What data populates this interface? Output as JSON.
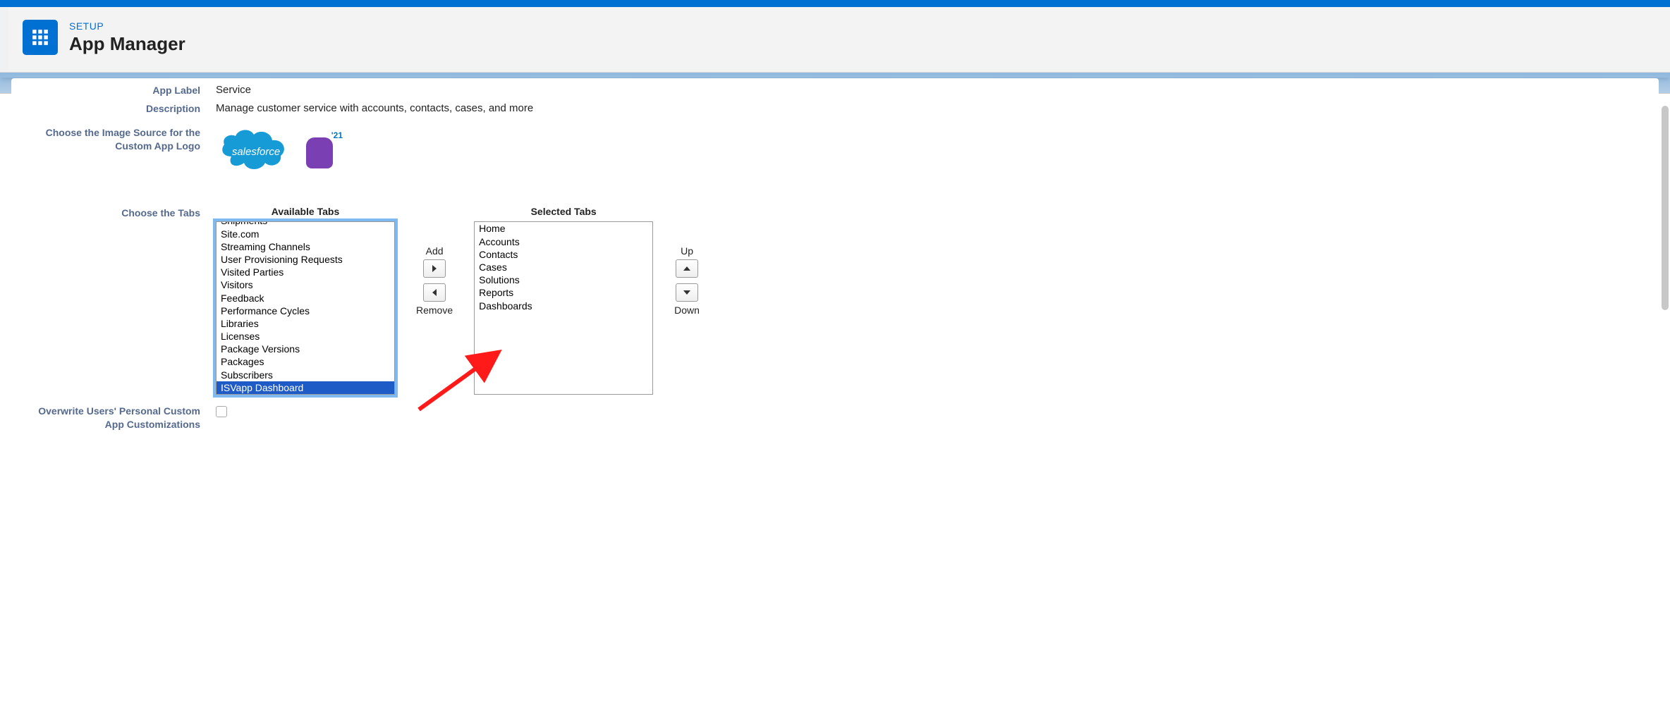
{
  "header": {
    "breadcrumb": "SETUP",
    "title": "App Manager"
  },
  "form": {
    "app_label_label": "App Label",
    "app_label_value": "Service",
    "description_label": "Description",
    "description_value": "Manage customer service with accounts, contacts, cases, and more",
    "image_source_label": "Choose the Image Source for the Custom App Logo",
    "choose_tabs_label": "Choose the Tabs",
    "mascot_year": "21",
    "cloud_text": "salesforce"
  },
  "tabs": {
    "available_title": "Available Tabs",
    "selected_title": "Selected Tabs",
    "add_label": "Add",
    "remove_label": "Remove",
    "up_label": "Up",
    "down_label": "Down",
    "available": [
      "Shipments",
      "Site.com",
      "Streaming Channels",
      "User Provisioning Requests",
      "Visited Parties",
      "Visitors",
      "Feedback",
      "Performance Cycles",
      "Libraries",
      "Licenses",
      "Package Versions",
      "Packages",
      "Subscribers",
      "ISVapp Dashboard"
    ],
    "available_selected_index": 13,
    "selected": [
      "Home",
      "Accounts",
      "Contacts",
      "Cases",
      "Solutions",
      "Reports",
      "Dashboards"
    ]
  },
  "overwrite": {
    "label": "Overwrite Users' Personal Custom App Customizations",
    "checked": false
  }
}
